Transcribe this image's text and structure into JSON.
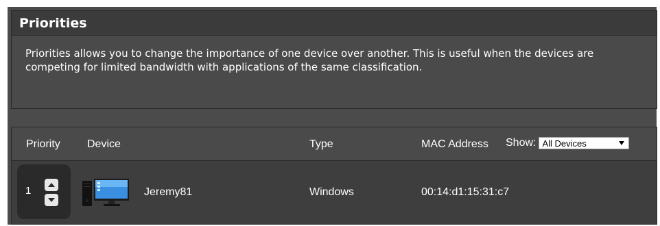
{
  "priorities": {
    "title": "Priorities",
    "description": "Priorities allows you to change the importance of one device over another. This is useful when the devices are competing for limited bandwidth with applications of the same classification."
  },
  "table": {
    "headers": {
      "priority": "Priority",
      "device": "Device",
      "type": "Type",
      "mac": "MAC Address"
    },
    "show_label": "Show:",
    "show_selected": "All Devices",
    "rows": [
      {
        "priority": "1",
        "device_icon": "desktop-computer-icon",
        "device": "Jeremy81",
        "type": "Windows",
        "mac": "00:14:d1:15:31:c7"
      }
    ]
  }
}
